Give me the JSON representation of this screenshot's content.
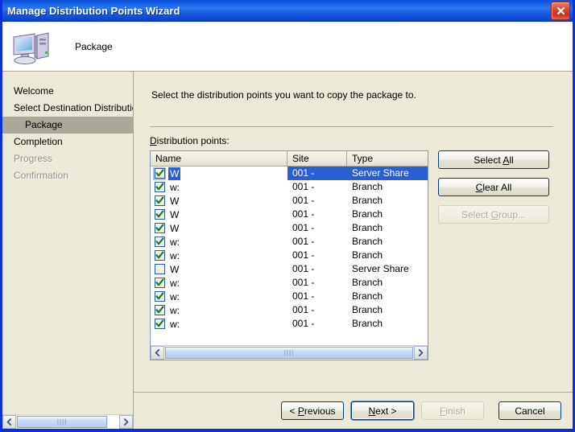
{
  "window": {
    "title": "Manage Distribution Points Wizard",
    "close_icon": "close-icon"
  },
  "header": {
    "icon": "computer-icon",
    "title": "Package"
  },
  "sidebar": {
    "items": [
      {
        "label": "Welcome",
        "state": "normal",
        "indent": false
      },
      {
        "label": "Select Destination Distribution P",
        "state": "normal",
        "indent": false
      },
      {
        "label": "Package",
        "state": "current",
        "indent": true
      },
      {
        "label": "Completion",
        "state": "normal",
        "indent": false
      },
      {
        "label": "Progress",
        "state": "disabled",
        "indent": false
      },
      {
        "label": "Confirmation",
        "state": "disabled",
        "indent": false
      }
    ],
    "scrollbar": {
      "left_icon": "chevron-left-icon",
      "right_icon": "chevron-right-icon",
      "grip": "||||"
    }
  },
  "main": {
    "instruction": "Select the distribution points you want to copy the package to.",
    "list_label_accel": "D",
    "list_label_rest": "istribution points:",
    "columns": [
      "Name",
      "Site",
      "Type"
    ],
    "rows": [
      {
        "checked": true,
        "name": "W",
        "site": "001 -",
        "type": "Server Share",
        "selected": true
      },
      {
        "checked": true,
        "name": "w:",
        "site": "001 -",
        "type": "Branch",
        "selected": false
      },
      {
        "checked": true,
        "name": "W",
        "site": "001 -",
        "type": "Branch",
        "selected": false
      },
      {
        "checked": true,
        "name": "W",
        "site": "001 -",
        "type": "Branch",
        "selected": false
      },
      {
        "checked": true,
        "name": "W",
        "site": "001 -",
        "type": "Branch",
        "selected": false
      },
      {
        "checked": true,
        "name": "w:",
        "site": "001 -",
        "type": "Branch",
        "selected": false
      },
      {
        "checked": true,
        "name": "w:",
        "site": "001 -",
        "type": "Branch",
        "selected": false
      },
      {
        "checked": false,
        "name": "W",
        "site": "001 -",
        "type": "Server Share",
        "selected": false
      },
      {
        "checked": true,
        "name": "w:",
        "site": "001 -",
        "type": "Branch",
        "selected": false
      },
      {
        "checked": true,
        "name": "w:",
        "site": "001 -",
        "type": "Branch",
        "selected": false
      },
      {
        "checked": true,
        "name": "w:",
        "site": "001 -",
        "type": "Branch",
        "selected": false
      },
      {
        "checked": true,
        "name": "w:",
        "site": "001 -",
        "type": "Branch",
        "selected": false
      }
    ],
    "list_scrollbar": {
      "left_icon": "chevron-left-icon",
      "right_icon": "chevron-right-icon",
      "grip": "||||"
    },
    "side_buttons": [
      {
        "pre": "Select ",
        "accel": "A",
        "post": "ll",
        "enabled": true
      },
      {
        "pre": "",
        "accel": "C",
        "post": "lear All",
        "enabled": true
      },
      {
        "pre": "Select ",
        "accel": "G",
        "post": "roup...",
        "enabled": false
      }
    ]
  },
  "footer": {
    "buttons": [
      {
        "pre": "< ",
        "accel": "P",
        "post": "revious",
        "enabled": true,
        "default": false
      },
      {
        "pre": "",
        "accel": "N",
        "post": "ext >",
        "enabled": true,
        "default": true
      },
      {
        "pre": "",
        "accel": "F",
        "post": "inish",
        "enabled": false,
        "default": false
      },
      {
        "pre": "",
        "accel": "",
        "post": "Cancel",
        "enabled": true,
        "default": false
      }
    ]
  },
  "colors": {
    "title_blue": "#0831d9",
    "face": "#ece9d8",
    "selection": "#2a5fd4",
    "close_red": "#d9452a",
    "check_green": "#208020"
  }
}
